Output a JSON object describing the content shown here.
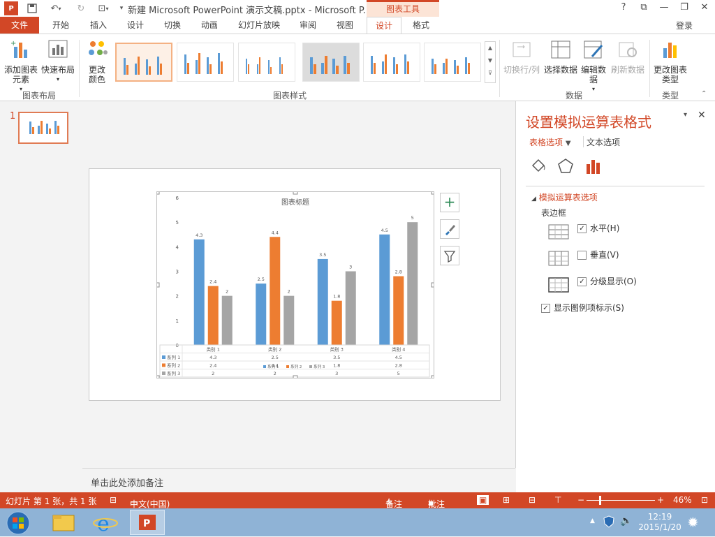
{
  "titlebar": {
    "doc_title": "新建 Microsoft PowerPoint 演示文稿.pptx - Microsoft P...",
    "context_tools": "图表工具",
    "help": "?",
    "win_restore_ribbon": "⧉",
    "win_min": "—",
    "win_max": "❐",
    "win_close": "✕"
  },
  "tabs": {
    "file": "文件",
    "items": [
      "开始",
      "插入",
      "设计",
      "切换",
      "动画",
      "幻灯片放映",
      "审阅",
      "视图",
      "设计",
      "格式"
    ],
    "active_index": 8,
    "login": "登录"
  },
  "ribbon": {
    "add_chart_element": "添加图表元素",
    "quick_layout": "快速布局",
    "change_colors": "更改颜色",
    "group_chart_layouts": "图表布局",
    "group_chart_styles": "图表样式",
    "switch_row_col": "切换行/列",
    "select_data": "选择数据",
    "edit_data": "编辑数据",
    "refresh_data": "刷新数据",
    "group_data": "数据",
    "change_chart_type": "更改图表类型",
    "group_type": "类型"
  },
  "thumbs": {
    "slide_number": "1"
  },
  "notes": {
    "placeholder": "单击此处添加备注"
  },
  "chart_data": {
    "type": "bar",
    "title": "图表标题",
    "categories": [
      "类别 1",
      "类别 2",
      "类别 3",
      "类别 4"
    ],
    "series": [
      {
        "name": "系列 1",
        "values": [
          4.3,
          2.5,
          3.5,
          4.5
        ],
        "color": "#5b9bd5"
      },
      {
        "name": "系列 2",
        "values": [
          2.4,
          4.4,
          1.8,
          2.8
        ],
        "color": "#ed7d31"
      },
      {
        "name": "系列 3",
        "values": [
          2,
          2,
          3,
          5
        ],
        "color": "#a5a5a5"
      }
    ],
    "ylim": [
      0,
      6
    ],
    "yticks": [
      "0",
      "1",
      "2",
      "3",
      "4",
      "5",
      "6"
    ],
    "data_table": true,
    "grid": false
  },
  "pane": {
    "title": "设置模拟运算表格式",
    "tab_table_options": "表格选项",
    "tab_text_options": "文本选项",
    "section": "模拟运算表选项",
    "borders_label": "表边框",
    "opt_horizontal": "水平(H)",
    "opt_vertical": "垂直(V)",
    "opt_outline": "分级显示(O)",
    "opt_legend_keys": "显示图例项标示(S)",
    "horizontal_checked": true,
    "vertical_checked": false,
    "outline_checked": true,
    "legend_keys_checked": true
  },
  "status": {
    "slide_info": "幻灯片 第 1 张，共 1 张",
    "language": "中文(中国)",
    "notes": "备注",
    "comments": "批注",
    "zoom": "46%"
  },
  "taskbar": {
    "time": "12:19",
    "date": "2015/1/20"
  },
  "colors": {
    "accent": "#d24726"
  }
}
